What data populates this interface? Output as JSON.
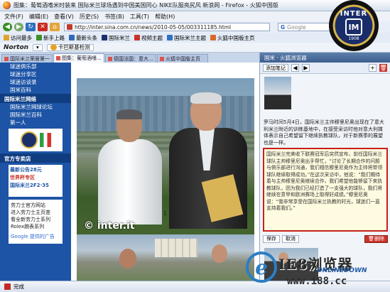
{
  "window": {
    "title": "图集：葡萄酒嗜米时装来 国际米兰球场遇到中国美国同心 NIKE队服亮尻风 新浪网 - Firefox - 火狐中国版"
  },
  "menu": [
    "文件(F)",
    "编辑(E)",
    "查看(V)",
    "历史(S)",
    "书签(B)",
    "工具(T)",
    "帮助(H)"
  ],
  "nav": {
    "url": "http://inter.sina.com.cn/news/2010-05-05/003311185.html",
    "search_placeholder": "Google",
    "search_logo": "G"
  },
  "bookmarks": [
    {
      "label": "访问最多",
      "color": "#e0a32b"
    },
    {
      "label": "新手上路",
      "color": "#3d8f2a"
    },
    {
      "label": "最新头条",
      "color": "#3167b8"
    },
    {
      "label": "国际米兰",
      "color": "#1b2f6b"
    },
    {
      "label": "视频主题",
      "color": "#c9322a"
    },
    {
      "label": "国际米兰主题",
      "color": "#2f71c2"
    },
    {
      "label": "火狐中国版主页",
      "color": "#d9692b"
    }
  ],
  "norton": {
    "logo": "Norton",
    "items": [
      "▾",
      "卡巴斯基检测"
    ]
  },
  "tabs": [
    {
      "label": "国际米兰荣居第一",
      "active": false
    },
    {
      "label": "图集：葡萄酒嗜...",
      "active": true
    },
    {
      "label": "德国法国：意大...",
      "active": false
    },
    {
      "label": "火狐中国版主页",
      "active": false
    }
  ],
  "left_sidebar": {
    "links_top": [
      "球迷俱乐部",
      "球迷分享区",
      "球迷访谈录",
      "国米百科"
    ],
    "section1": "国际米兰网络",
    "links_mid": [
      "国际米兰网球论坛",
      "国际米兰百科",
      "第一人"
    ],
    "section2": "官方专卖店",
    "ad1_lines": [
      "最新公告28元",
      "世界杯专区",
      "国际米兰2F2·35"
    ],
    "ad2_lines": [
      "劳力士官方网站",
      "进入劳力士主页查",
      "看全新劳力士系列",
      "Rolex腕表系列"
    ],
    "ad2_footer": "Google 提供的广告"
  },
  "main": {
    "watermark": "© inter.it",
    "caption_num": "1"
  },
  "right_panel": {
    "header": "国米 · 火狐浏览器",
    "tools": [
      "添加笔记",
      "◀",
      "▶",
      "+"
    ],
    "delete_icon": "🗑",
    "text1": "罗马时间5月4日，国际米兰主帅穆里尼奥出现在了意大利米兰附近的训练基地中，在接受采访时他对意大利媒体表示自己希望留下继续执教球队，对于新赛季的展望也是一样。",
    "note_text": "国际米兰完美收下联赛冠军后突然宣布，前任国际米兰球队主帅穆里尼奥出手帮忙，“讨论了长期合作的问题与俱乐部进行沟通，我们相信穆里尼奥作为主帅将带领球队继续取得成功。”在这次采访中，他说：“我们期待着与主帅穆里尼奥继续合作，我们希望他能够留下来执教球队，因为我们已经打造了一支强大的球队，我们将继续在意甲和欧洲赛场上取得好成绩。”穆里尼奥说：“我非常享受在国际米兰执教的时光，球迷们一直支持着我们。”",
    "actions": [
      "保存",
      "取消",
      "删除"
    ],
    "delete_action_icon": "🗑"
  },
  "interlogo": {
    "name": "INTER",
    "monogram": "IM",
    "year": "1908"
  },
  "status": {
    "text": "完成"
  },
  "site_watermark": {
    "cn": "IE8浏览器",
    "en": "ONLINEDOWN",
    "url": "www.i88.cc"
  }
}
